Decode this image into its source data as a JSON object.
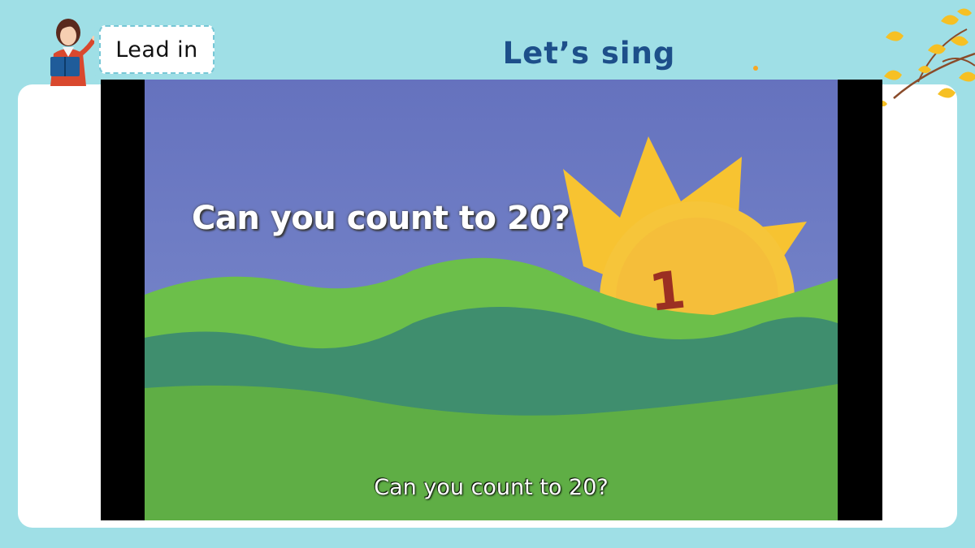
{
  "header": {
    "badge_label": "Lead in",
    "title": "Let’s sing"
  },
  "video": {
    "title_text": "Can you count to 20?",
    "number_on_hill": "1",
    "subtitle": "Can you count to 20?"
  },
  "colors": {
    "background": "#9fdfe6",
    "title": "#1d4f8a",
    "badge_border": "#77c7d6",
    "sky": "#6f7fc4",
    "sun": "#f8c23a",
    "hill_light": "#6cbf4a",
    "hill_dark": "#3f8e6e"
  },
  "icons": [
    "teacher-illustration-icon",
    "ginkgo-leaves-icon"
  ]
}
